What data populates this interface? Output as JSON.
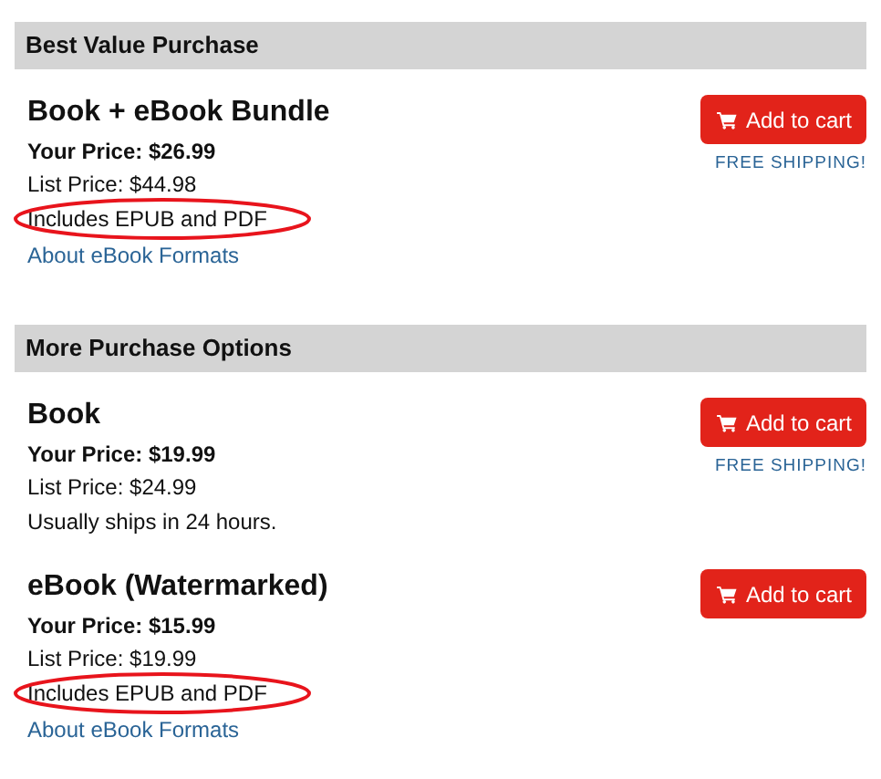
{
  "sections": [
    {
      "title": "Best Value Purchase",
      "products": [
        {
          "name": "Book + eBook Bundle",
          "your_price": "Your Price: $26.99",
          "list_price": "List Price: $44.98",
          "button": "Add to cart",
          "shipping": "FREE SHIPPING!",
          "lines": [
            {
              "kind": "note",
              "text": "Includes EPUB and PDF",
              "circled": true
            },
            {
              "kind": "link",
              "text": "About eBook Formats",
              "circled": false
            }
          ]
        }
      ]
    },
    {
      "title": "More Purchase Options",
      "products": [
        {
          "name": "Book",
          "your_price": "Your Price: $19.99",
          "list_price": "List Price: $24.99",
          "button": "Add to cart",
          "shipping": "FREE SHIPPING!",
          "lines": [
            {
              "kind": "note",
              "text": "Usually ships in 24 hours.",
              "circled": false
            }
          ]
        },
        {
          "name": "eBook (Watermarked)",
          "your_price": "Your Price: $15.99",
          "list_price": "List Price: $19.99",
          "button": "Add to cart",
          "lines": [
            {
              "kind": "note",
              "text": "Includes EPUB and PDF",
              "circled": true
            },
            {
              "kind": "link",
              "text": "About eBook Formats",
              "circled": false
            }
          ]
        }
      ]
    }
  ]
}
